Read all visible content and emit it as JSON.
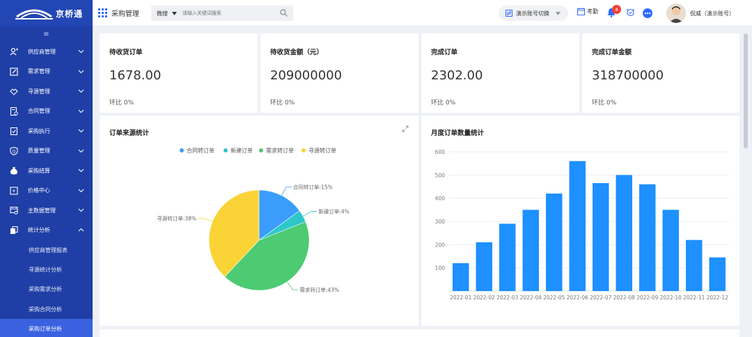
{
  "brand": {
    "name": "京桥通"
  },
  "topbar": {
    "app_title": "采购管理",
    "search_type": "微搜",
    "search_placeholder": "请输入关键词搜索",
    "switch_label": "演示账号切换",
    "attendance_label": "考勤",
    "notification_count": "4",
    "user_name": "倪威（演示账号）"
  },
  "sidebar": {
    "collapse_glyph": "≡",
    "items": [
      {
        "label": "供应商管理",
        "icon": "user-add-icon"
      },
      {
        "label": "需求管理",
        "icon": "edit-icon"
      },
      {
        "label": "寻源管理",
        "icon": "handshake-icon"
      },
      {
        "label": "合同管理",
        "icon": "contract-icon"
      },
      {
        "label": "采购执行",
        "icon": "clipboard-check-icon"
      },
      {
        "label": "质量管理",
        "icon": "shield-icon"
      },
      {
        "label": "采购结算",
        "icon": "money-bag-icon"
      },
      {
        "label": "价格中心",
        "icon": "price-tag-icon"
      },
      {
        "label": "主数据管理",
        "icon": "database-icon"
      },
      {
        "label": "统计分析",
        "icon": "copy-icon"
      }
    ],
    "sub_items": [
      {
        "label": "供应商管理报表"
      },
      {
        "label": "寻源统计分析"
      },
      {
        "label": "采购需求分析"
      },
      {
        "label": "采购合同分析"
      },
      {
        "label": "采购订单分析"
      }
    ],
    "active_sub": 4
  },
  "stats": [
    {
      "title": "待收货订单",
      "value": "1678.00",
      "compare": "环比  0%"
    },
    {
      "title": "待收货金额（元）",
      "value": "209000000",
      "compare": "环比  0%"
    },
    {
      "title": "完成订单",
      "value": "2302.00",
      "compare": "环比  0%"
    },
    {
      "title": "完成订单金额",
      "value": "318700000",
      "compare": "环比  0%"
    }
  ],
  "colors": {
    "sidebar": "#1f3fa6",
    "active": "#3a62e0",
    "bar": "#1e90ff"
  },
  "chart_data": [
    {
      "type": "pie",
      "title": "订单来源统计",
      "legend_placement": "top",
      "slices": [
        {
          "name": "合同转订单",
          "value": 15,
          "label": "合同转订单:15%",
          "color": "#3a9dfb"
        },
        {
          "name": "新建订单",
          "value": 4,
          "label": "新建订单:4%",
          "color": "#2ec7c9"
        },
        {
          "name": "需求转订单",
          "value": 43,
          "label": "需求转订单:43%",
          "color": "#4ccb73"
        },
        {
          "name": "寻源转订单",
          "value": 38,
          "label": "寻源转订单:38%",
          "color": "#fad337"
        }
      ]
    },
    {
      "type": "bar",
      "title": "月度订单数量统计",
      "categories": [
        "2022-01",
        "2022-02",
        "2022-03",
        "2022-04",
        "2022-05",
        "2022-06",
        "2022-07",
        "2022-08",
        "2022-09",
        "2022-10",
        "2022-11",
        "2022-12"
      ],
      "values": [
        120,
        210,
        290,
        350,
        420,
        560,
        465,
        500,
        460,
        350,
        220,
        145
      ],
      "ylim": [
        0,
        600
      ],
      "yticks": [
        100,
        200,
        300,
        400,
        500,
        600
      ],
      "grid": true
    }
  ]
}
